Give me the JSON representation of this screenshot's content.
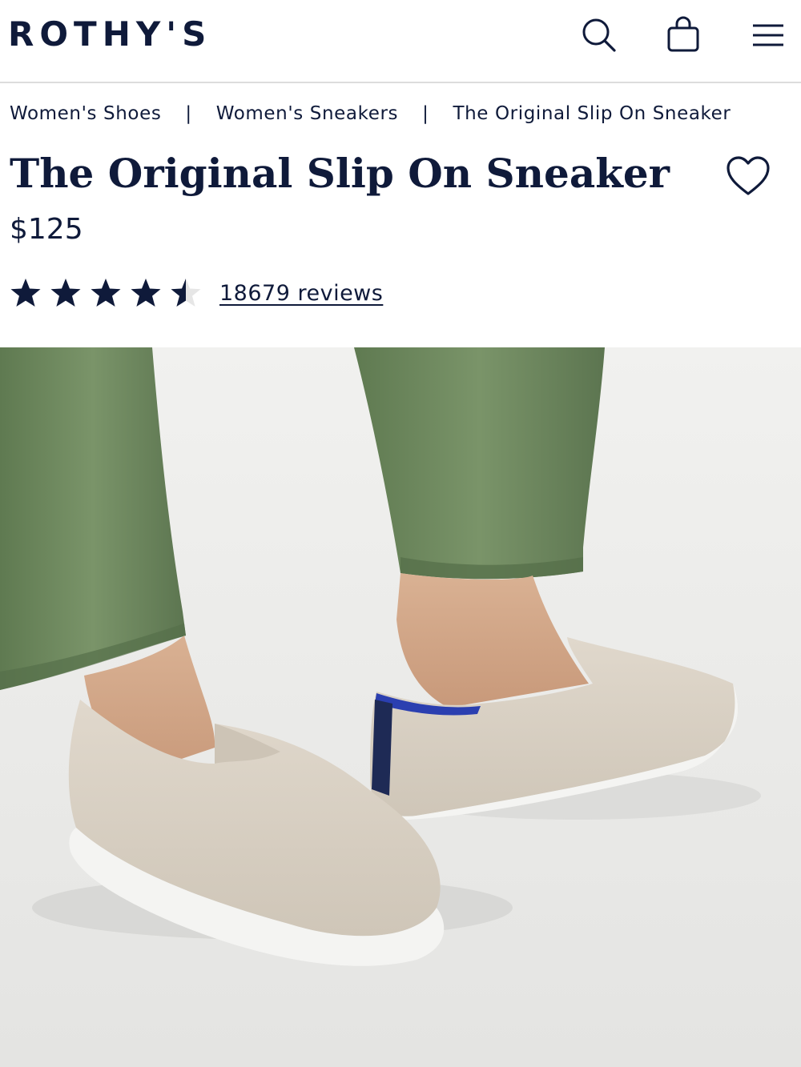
{
  "header": {
    "logo": "ROTHY'S",
    "icons": [
      "search-icon",
      "shopping-bag-icon",
      "menu-icon"
    ]
  },
  "breadcrumb": {
    "items": [
      "Women's Shoes",
      "Women's Sneakers",
      "The Original Slip On Sneaker"
    ],
    "separator": "|"
  },
  "product": {
    "title": "The Original Slip On Sneaker",
    "price": "$125",
    "rating_value": 4.5,
    "rating_max": 5,
    "reviews_label": "18679 reviews",
    "favorite_icon": "heart-icon"
  },
  "hero_image": {
    "alt_subject": "beige knit slip-on sneakers with green pants"
  },
  "colors": {
    "navy": "#0f1a3a",
    "pants_green": "#6f8a60",
    "shoe_beige": "#d8d0c4",
    "sole_white": "#f4f4f2",
    "background": "#e9e9e7"
  }
}
